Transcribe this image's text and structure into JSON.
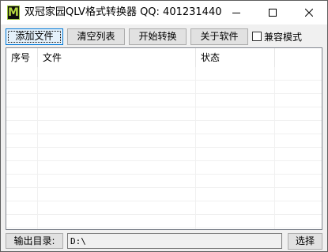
{
  "titlebar": {
    "app_icon_letter": "M",
    "title": "双冠家园QLV格式转换器 QQ: 401231440",
    "minimize_icon": "minimize-icon",
    "maximize_icon": "maximize-icon",
    "close_icon": "close-icon"
  },
  "toolbar": {
    "add_file": "添加文件",
    "clear_list": "清空列表",
    "start_convert": "开始转换",
    "about": "关于软件",
    "compat_mode": "兼容模式",
    "compat_mode_checked": false
  },
  "list": {
    "columns": [
      "序号",
      "文件",
      "状态"
    ],
    "rows": []
  },
  "output": {
    "label": "输出目录:",
    "path": "D:\\",
    "choose": "选择"
  },
  "colors": {
    "titlebar_bg": "#ffffff",
    "window_bg": "#f0f0f0",
    "focus_border": "#0078d7",
    "icon_green": "#b5d840"
  }
}
